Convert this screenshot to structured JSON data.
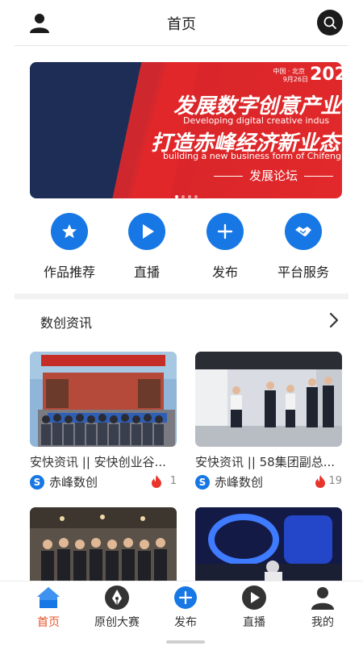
{
  "header": {
    "title": "首页",
    "user_icon": "user-icon",
    "search_icon": "search-icon"
  },
  "banner": {
    "meta_location": "中国 · 北京",
    "meta_date": "9月26日",
    "year": "202",
    "headline_1": "发展数字创意产业",
    "subline_1": "Developing digital creative indus",
    "headline_2": "打造赤峰经济新业态",
    "subline_2": "building a new business form of Chifeng econ",
    "forum": "发展论坛",
    "carousel": {
      "count": 4,
      "active_index": 0
    }
  },
  "quick_actions": [
    {
      "label": "作品推荐",
      "icon": "star-icon"
    },
    {
      "label": "直播",
      "icon": "play-icon"
    },
    {
      "label": "发布",
      "icon": "plus-icon"
    },
    {
      "label": "平台服务",
      "icon": "handshake-icon"
    }
  ],
  "section": {
    "title": "数创资讯",
    "arrow_icon": "chevron-right-icon"
  },
  "cards": [
    {
      "title": "安快资讯 || 安快创业谷...",
      "author": "赤峰数创",
      "views": "1",
      "logo_icon": "brand-s-icon"
    },
    {
      "title": "安快资讯 || 58集团副总...",
      "author": "赤峰数创",
      "views": "19",
      "logo_icon": "brand-s-icon"
    },
    {
      "title": "",
      "author": "",
      "views": ""
    },
    {
      "title": "",
      "author": "",
      "views": ""
    }
  ],
  "tabbar": [
    {
      "label": "首页",
      "icon": "home-icon",
      "active": true
    },
    {
      "label": "原创大赛",
      "icon": "pen-nib-icon",
      "active": false
    },
    {
      "label": "发布",
      "icon": "plus-circle-icon",
      "active": false
    },
    {
      "label": "直播",
      "icon": "play-circle-icon",
      "active": false
    },
    {
      "label": "我的",
      "icon": "profile-icon",
      "active": false
    }
  ],
  "colors": {
    "accent": "#1677e5",
    "active_tab": "#e8542b",
    "banner_red": "#e2282a",
    "banner_navy": "#1d2d55",
    "flame": "#e8352b"
  }
}
